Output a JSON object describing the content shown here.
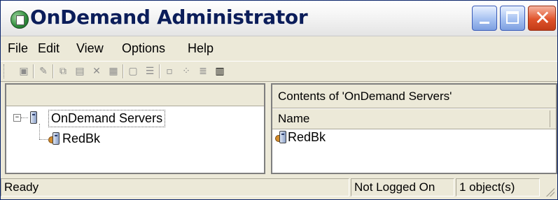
{
  "window": {
    "title": "OnDemand Administrator",
    "icon": "app-globe-icon",
    "controls": {
      "minimize": "minimize",
      "maximize": "maximize",
      "close": "close"
    }
  },
  "menu": {
    "items": [
      "File",
      "Edit",
      "View",
      "Options",
      "Help"
    ]
  },
  "toolbar": {
    "icons": [
      "new-icon",
      "properties-icon",
      "copy-icon",
      "paste-icon",
      "delete-icon",
      "clipboard-icon",
      "view-icon",
      "settings-icon",
      "large-icons-icon",
      "small-icons-icon",
      "list-icon",
      "details-icon"
    ]
  },
  "tree": {
    "expander": "−",
    "root_label": "OnDemand Servers",
    "child_label": "RedBk"
  },
  "contents": {
    "title": "Contents of 'OnDemand Servers'",
    "column_name": "Name",
    "rows": [
      "RedBk"
    ]
  },
  "status": {
    "message": "Ready",
    "login": "Not Logged On",
    "count": "1 object(s)"
  },
  "colors": {
    "title_text": "#0b1d5a",
    "chrome": "#ece9d8",
    "close_button": "#e0532b"
  }
}
